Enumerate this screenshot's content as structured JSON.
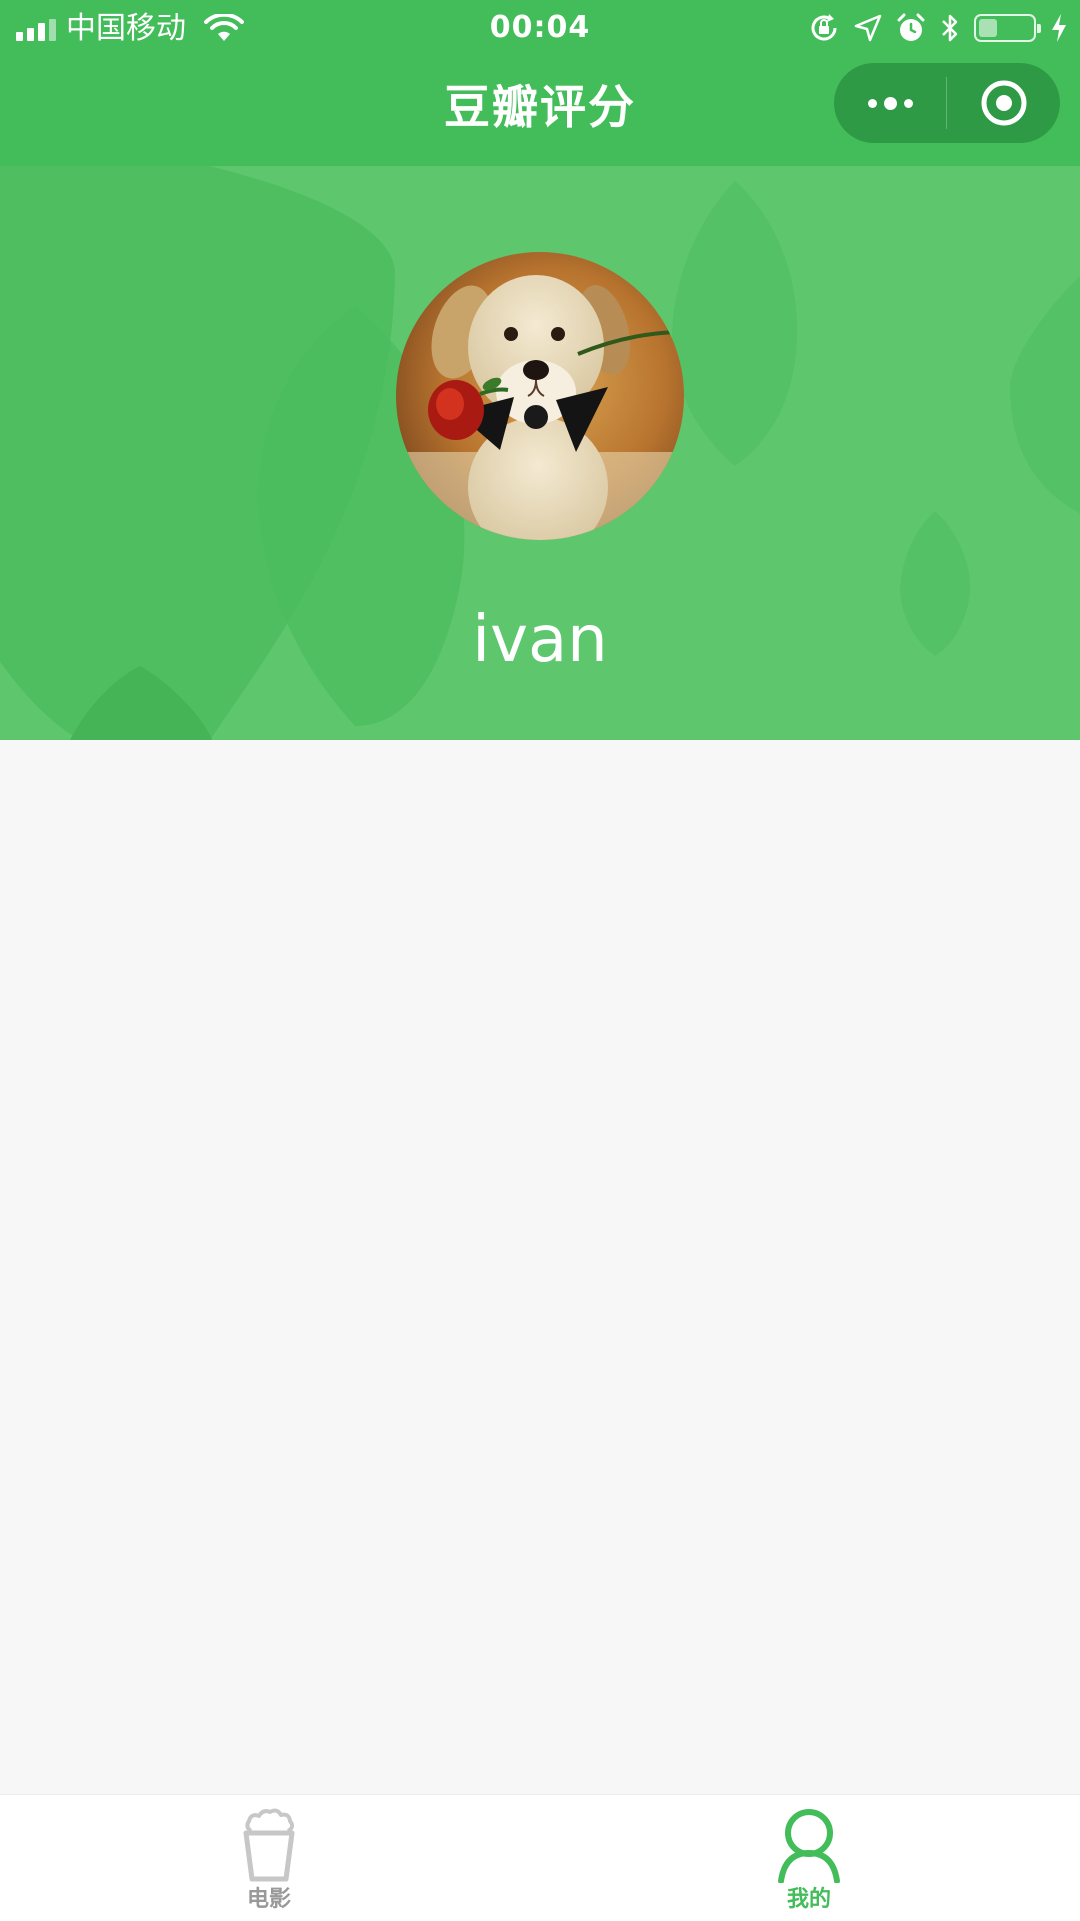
{
  "status_bar": {
    "carrier": "中国移动",
    "time": "00:04",
    "signal_icon": "signal-bars-icon",
    "wifi_icon": "wifi-icon",
    "battery_level": 0.35
  },
  "nav": {
    "title": "豆瓣评分",
    "more_icon": "more-dots-icon",
    "close_icon": "target-circle-icon"
  },
  "profile": {
    "username": "ivan",
    "avatar": "puppy-with-rose"
  },
  "tab_bar": {
    "items": [
      {
        "label": "电影",
        "icon": "popcorn-icon",
        "active": false
      },
      {
        "label": "我的",
        "icon": "person-icon",
        "active": true
      }
    ]
  },
  "colors": {
    "brand_green": "#43bd5a",
    "header_green": "#5ec76e",
    "page_bg": "#f7f7f7",
    "inactive_tab": "#999999"
  }
}
